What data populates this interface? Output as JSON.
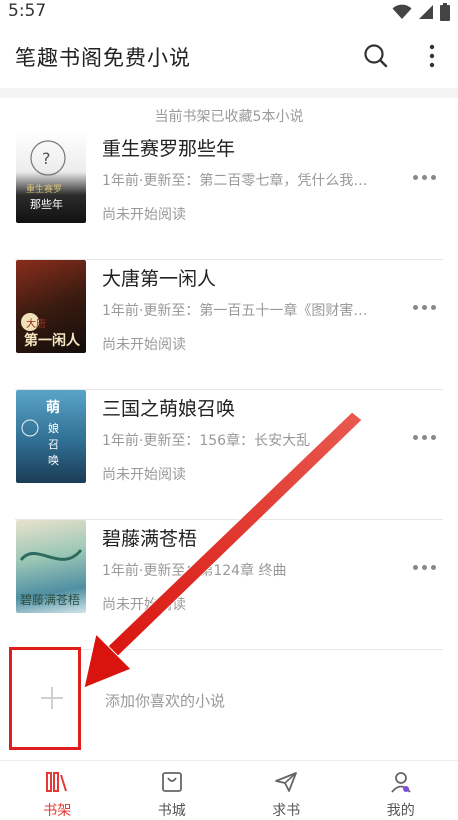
{
  "status_bar": {
    "time": "5:57",
    "icons": [
      "wifi-icon",
      "signal-icon",
      "battery-icon"
    ]
  },
  "app_bar": {
    "title": "笔趣书阁免费小说",
    "icons": [
      "search-icon",
      "more-vert-icon"
    ]
  },
  "shelf": {
    "summary": "当前书架已收藏5本小说",
    "books": [
      {
        "title": "重生赛罗那些年",
        "update": "1年前·更新至：第二百零七章，凭什么我…",
        "status": "尚未开始阅读",
        "cover_text": "重生赛罗 那些年"
      },
      {
        "title": "大唐第一闲人",
        "update": "1年前·更新至：第一百五十一章《图财害…",
        "status": "尚未开始阅读",
        "cover_text": "大唐 第一闲人"
      },
      {
        "title": "三国之萌娘召唤",
        "update": "1年前·更新至：156章：长安大乱",
        "status": "尚未开始阅读",
        "cover_text": "萌娘召唤"
      },
      {
        "title": "碧藤满苍梧",
        "update": "1年前·更新至：第124章 终曲",
        "status": "尚未开始阅读",
        "cover_text": "碧藤满苍梧"
      }
    ],
    "add_label": "添加你喜欢的小说"
  },
  "bottom_nav": [
    {
      "label": "书架",
      "icon": "bookshelf-icon",
      "active": true
    },
    {
      "label": "书城",
      "icon": "store-bag-icon",
      "active": false
    },
    {
      "label": "求书",
      "icon": "paper-plane-icon",
      "active": false
    },
    {
      "label": "我的",
      "icon": "user-icon",
      "active": false
    }
  ],
  "colors": {
    "accent": "#e53935",
    "annotation": "#e11d1d",
    "text_primary": "#222222",
    "text_secondary": "#999999"
  }
}
